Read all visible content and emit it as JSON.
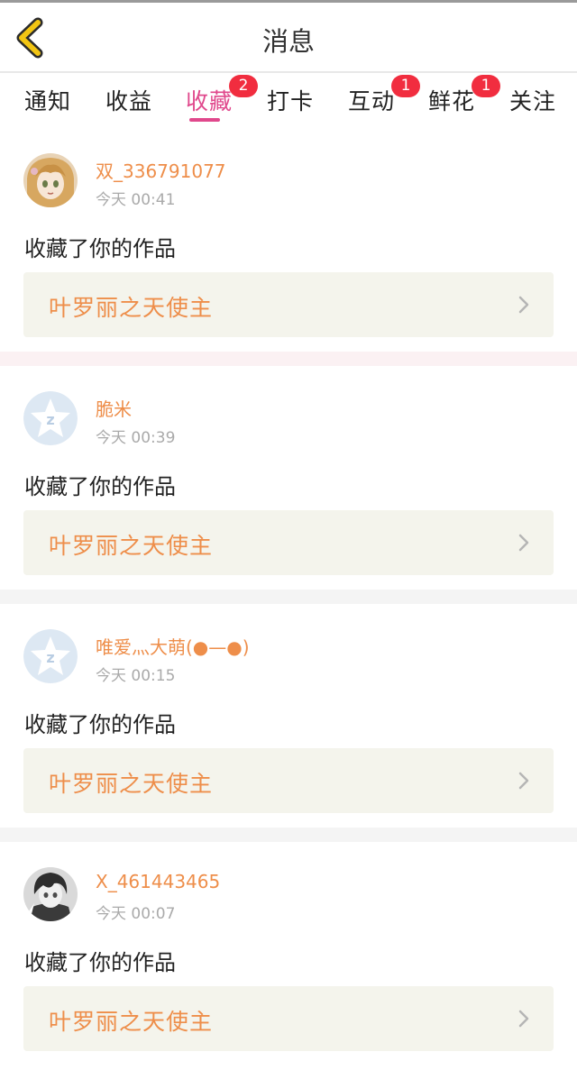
{
  "header": {
    "title": "消息"
  },
  "tabs": [
    {
      "label": "通知",
      "badge": null,
      "active": false
    },
    {
      "label": "收益",
      "badge": null,
      "active": false
    },
    {
      "label": "收藏",
      "badge": "2",
      "active": true
    },
    {
      "label": "打卡",
      "badge": null,
      "active": false
    },
    {
      "label": "互动",
      "badge": "1",
      "active": false
    },
    {
      "label": "鲜花",
      "badge": "1",
      "active": false
    },
    {
      "label": "关注",
      "badge": null,
      "active": false
    }
  ],
  "messages": [
    {
      "username": "双_336791077",
      "time": "今天 00:41",
      "action": "收藏了你的作品",
      "work_title": "叶罗丽之天使主",
      "avatar": "anime-girl-avatar"
    },
    {
      "username": "脆米",
      "time": "今天 00:39",
      "action": "收藏了你的作品",
      "work_title": "叶罗丽之天使主",
      "avatar": "default-star-avatar"
    },
    {
      "username": "唯爱灬大萌(●—●)",
      "time": "今天 00:15",
      "action": "收藏了你的作品",
      "work_title": "叶罗丽之天使主",
      "avatar": "default-star-avatar"
    },
    {
      "username": "X_461443465",
      "time": "今天 00:07",
      "action": "收藏了你的作品",
      "work_title": "叶罗丽之天使主",
      "avatar": "anime-boy-avatar"
    }
  ],
  "colors": {
    "accent": "#e0488c",
    "badge": "#f12d3f",
    "link": "#ee8e4a",
    "back_icon": "#f2c513"
  }
}
